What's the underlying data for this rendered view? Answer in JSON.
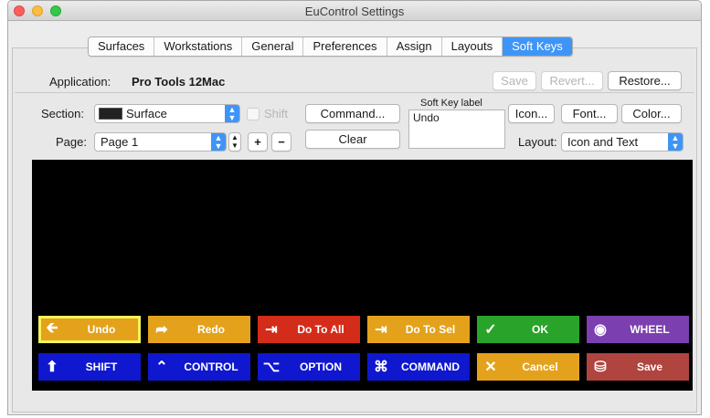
{
  "window": {
    "title": "EuControl Settings"
  },
  "tabs": [
    {
      "label": "Surfaces",
      "active": false
    },
    {
      "label": "Workstations",
      "active": false
    },
    {
      "label": "General",
      "active": false
    },
    {
      "label": "Preferences",
      "active": false
    },
    {
      "label": "Assign",
      "active": false
    },
    {
      "label": "Layouts",
      "active": false
    },
    {
      "label": "Soft Keys",
      "active": true
    }
  ],
  "application": {
    "label": "Application:",
    "value": "Pro Tools 12Mac"
  },
  "top_buttons": {
    "save": "Save",
    "revert": "Revert...",
    "restore": "Restore..."
  },
  "section": {
    "label": "Section:",
    "value": "Surface",
    "shift_label": "Shift"
  },
  "page": {
    "label": "Page:",
    "value": "Page 1",
    "plus": "+",
    "minus": "−"
  },
  "command_buttons": {
    "command": "Command...",
    "clear": "Clear"
  },
  "soft_key_label": {
    "label": "Soft Key label",
    "value": "Undo"
  },
  "style_buttons": {
    "icon": "Icon...",
    "font": "Font...",
    "color": "Color..."
  },
  "layout": {
    "label": "Layout:",
    "value": "Icon and Text"
  },
  "soft_keys": [
    {
      "label": "Undo",
      "icon": "undo-arrow-icon",
      "glyph": "🡰",
      "color": "#e4a21c",
      "selected": true
    },
    {
      "label": "Redo",
      "icon": "redo-arrow-icon",
      "glyph": "➦",
      "color": "#e4a21c",
      "selected": false
    },
    {
      "label": "Do To All",
      "icon": "do-to-all-icon",
      "glyph": "⇥",
      "color": "#d42c1a",
      "selected": false
    },
    {
      "label": "Do To Sel",
      "icon": "do-to-sel-icon",
      "glyph": "⇥",
      "color": "#e4a21c",
      "selected": false
    },
    {
      "label": "OK",
      "icon": "checkmark-icon",
      "glyph": "✓",
      "color": "#2aa32a",
      "selected": false
    },
    {
      "label": "WHEEL",
      "icon": "wheel-icon",
      "glyph": "◉",
      "color": "#7b3fb0",
      "selected": false
    },
    {
      "label": "SHIFT",
      "icon": "shift-arrow-icon",
      "glyph": "⬆",
      "color": "#0f17cf",
      "selected": false
    },
    {
      "label": "CONTROL",
      "icon": "control-caret-icon",
      "glyph": "⌃",
      "color": "#0f17cf",
      "selected": false
    },
    {
      "label": "OPTION",
      "icon": "option-key-icon",
      "glyph": "⌥",
      "color": "#0f17cf",
      "selected": false
    },
    {
      "label": "COMMAND",
      "icon": "command-key-icon",
      "glyph": "⌘",
      "color": "#0f17cf",
      "selected": false
    },
    {
      "label": "Cancel",
      "icon": "x-cancel-icon",
      "glyph": "✕",
      "color": "#e4a21c",
      "selected": false
    },
    {
      "label": "Save",
      "icon": "save-disk-icon",
      "glyph": "⛁",
      "color": "#b0443f",
      "selected": false
    }
  ]
}
